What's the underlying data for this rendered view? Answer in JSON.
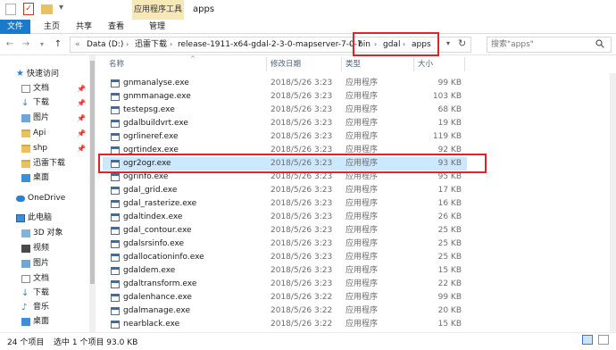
{
  "titlebar": {
    "context_tab": "应用程序工具",
    "title": "apps"
  },
  "ribbon": {
    "tabs": [
      "文件",
      "主页",
      "共享",
      "查看",
      "管理"
    ]
  },
  "address": {
    "crumbs": [
      "Data (D:)",
      "迅雷下载",
      "release-1911-x64-gdal-2-3-0-mapserver-7-0-7",
      "bin",
      "gdal",
      "apps"
    ],
    "search_placeholder": "搜索\"apps\""
  },
  "navpane": {
    "quick_access": "快速访问",
    "quick_items": [
      "文档",
      "下载",
      "图片",
      "Api",
      "shp",
      "迅雷下载",
      "桌面"
    ],
    "onedrive": "OneDrive",
    "this_pc": "此电脑",
    "pc_items": [
      "3D 对象",
      "视频",
      "图片",
      "文档",
      "下载",
      "音乐",
      "桌面"
    ]
  },
  "columns": {
    "name": "名称",
    "date": "修改日期",
    "type": "类型",
    "size": "大小"
  },
  "files": [
    {
      "name": "gnmanalyse.exe",
      "date": "2018/5/26 3:23",
      "type": "应用程序",
      "size": "99 KB"
    },
    {
      "name": "gnmmanage.exe",
      "date": "2018/5/26 3:23",
      "type": "应用程序",
      "size": "103 KB"
    },
    {
      "name": "testepsg.exe",
      "date": "2018/5/26 3:23",
      "type": "应用程序",
      "size": "68 KB"
    },
    {
      "name": "gdalbuildvrt.exe",
      "date": "2018/5/26 3:23",
      "type": "应用程序",
      "size": "19 KB"
    },
    {
      "name": "ogrlineref.exe",
      "date": "2018/5/26 3:23",
      "type": "应用程序",
      "size": "119 KB"
    },
    {
      "name": "ogrtindex.exe",
      "date": "2018/5/26 3:23",
      "type": "应用程序",
      "size": "92 KB"
    },
    {
      "name": "ogr2ogr.exe",
      "date": "2018/5/26 3:23",
      "type": "应用程序",
      "size": "93 KB"
    },
    {
      "name": "ogrinfo.exe",
      "date": "2018/5/26 3:23",
      "type": "应用程序",
      "size": "95 KB"
    },
    {
      "name": "gdal_grid.exe",
      "date": "2018/5/26 3:23",
      "type": "应用程序",
      "size": "17 KB"
    },
    {
      "name": "gdal_rasterize.exe",
      "date": "2018/5/26 3:23",
      "type": "应用程序",
      "size": "16 KB"
    },
    {
      "name": "gdaltindex.exe",
      "date": "2018/5/26 3:23",
      "type": "应用程序",
      "size": "26 KB"
    },
    {
      "name": "gdal_contour.exe",
      "date": "2018/5/26 3:23",
      "type": "应用程序",
      "size": "25 KB"
    },
    {
      "name": "gdalsrsinfo.exe",
      "date": "2018/5/26 3:23",
      "type": "应用程序",
      "size": "25 KB"
    },
    {
      "name": "gdallocationinfo.exe",
      "date": "2018/5/26 3:23",
      "type": "应用程序",
      "size": "25 KB"
    },
    {
      "name": "gdaldem.exe",
      "date": "2018/5/26 3:23",
      "type": "应用程序",
      "size": "15 KB"
    },
    {
      "name": "gdaltransform.exe",
      "date": "2018/5/26 3:23",
      "type": "应用程序",
      "size": "22 KB"
    },
    {
      "name": "gdalenhance.exe",
      "date": "2018/5/26 3:22",
      "type": "应用程序",
      "size": "99 KB"
    },
    {
      "name": "gdalmanage.exe",
      "date": "2018/5/26 3:22",
      "type": "应用程序",
      "size": "20 KB"
    },
    {
      "name": "nearblack.exe",
      "date": "2018/5/26 3:22",
      "type": "应用程序",
      "size": "15 KB"
    }
  ],
  "status": {
    "count": "24 个项目",
    "selected": "选中 1 个项目  93.0 KB"
  }
}
